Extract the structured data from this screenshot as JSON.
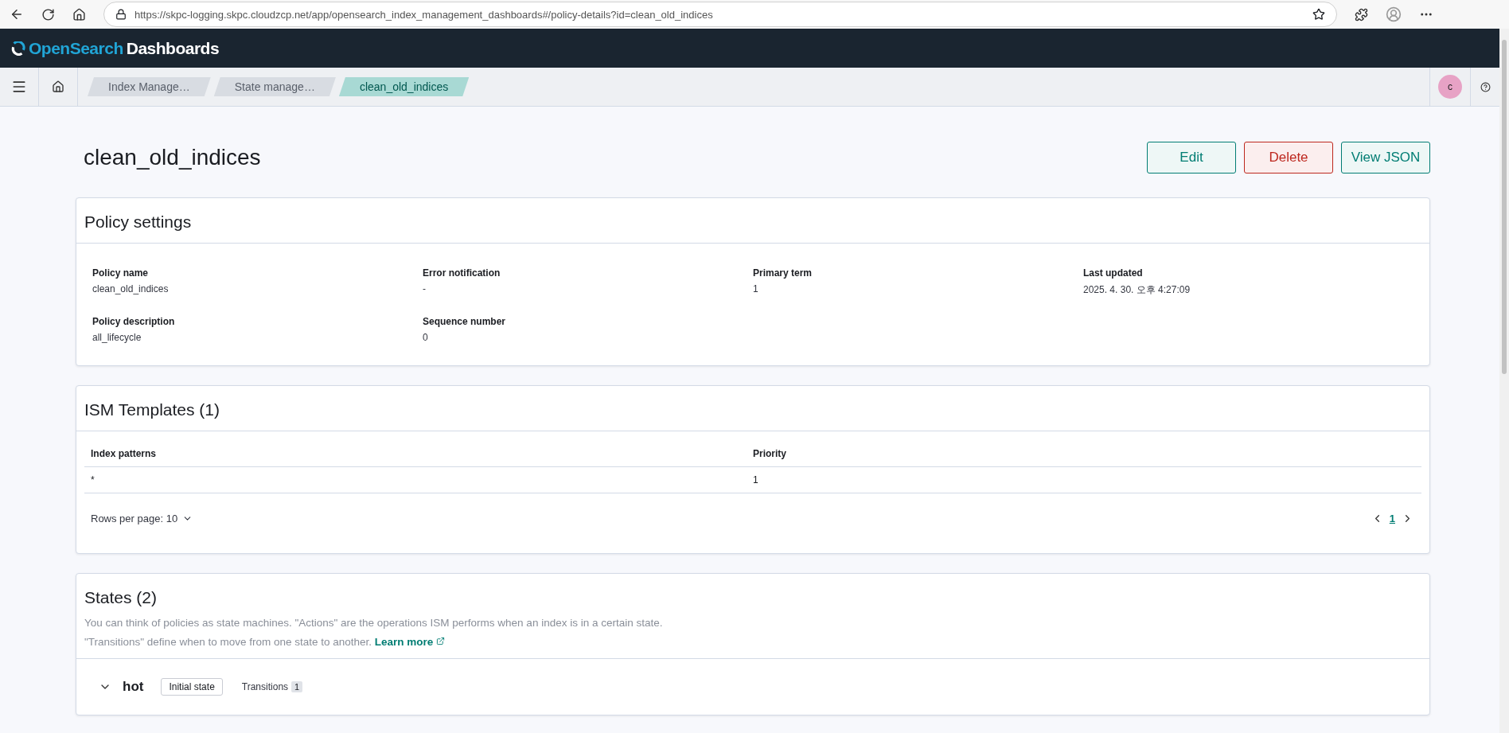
{
  "browser": {
    "url": "https://skpc-logging.skpc.cloudzcp.net/app/opensearch_index_management_dashboards#/policy-details?id=clean_old_indices"
  },
  "header": {
    "logo_bold": "OpenSearch",
    "logo_rest": "Dashboards"
  },
  "breadcrumbs": [
    {
      "label": "Index Manage…",
      "selected": false
    },
    {
      "label": "State manage…",
      "selected": false
    },
    {
      "label": "clean_old_indices",
      "selected": true
    }
  ],
  "avatar": {
    "initial": "c"
  },
  "page": {
    "title": "clean_old_indices",
    "buttons": [
      {
        "label": "Edit",
        "kind": "primary"
      },
      {
        "label": "Delete",
        "kind": "danger"
      },
      {
        "label": "View JSON",
        "kind": "primary"
      }
    ]
  },
  "policy_settings": {
    "title": "Policy settings",
    "fields": [
      {
        "label": "Policy name",
        "value": "clean_old_indices"
      },
      {
        "label": "Error notification",
        "value": "-"
      },
      {
        "label": "Primary term",
        "value": "1"
      },
      {
        "label": "Last updated",
        "value": "2025. 4. 30. 오후 4:27:09"
      },
      {
        "label": "Policy description",
        "value": "all_lifecycle"
      },
      {
        "label": "Sequence number",
        "value": "0"
      }
    ]
  },
  "ism_templates": {
    "title": "ISM Templates (1)",
    "columns": [
      "Index patterns",
      "Priority"
    ],
    "rows": [
      [
        "*",
        "1"
      ]
    ],
    "rows_per_page": "Rows per page: 10",
    "pages": [
      {
        "label": "1",
        "selected": true
      }
    ]
  },
  "states": {
    "title": "States (2)",
    "description_1": "You can think of policies as state machines. \"Actions\" are the operations ISM performs when an index is in a certain state.",
    "description_2": "\"Transitions\" define when to move from one state to another.",
    "learn_more": "Learn more",
    "items": [
      {
        "name": "hot",
        "expanded": true,
        "badge": "Initial state",
        "transitions_label": "Transitions",
        "transitions_count": "1"
      }
    ]
  }
}
